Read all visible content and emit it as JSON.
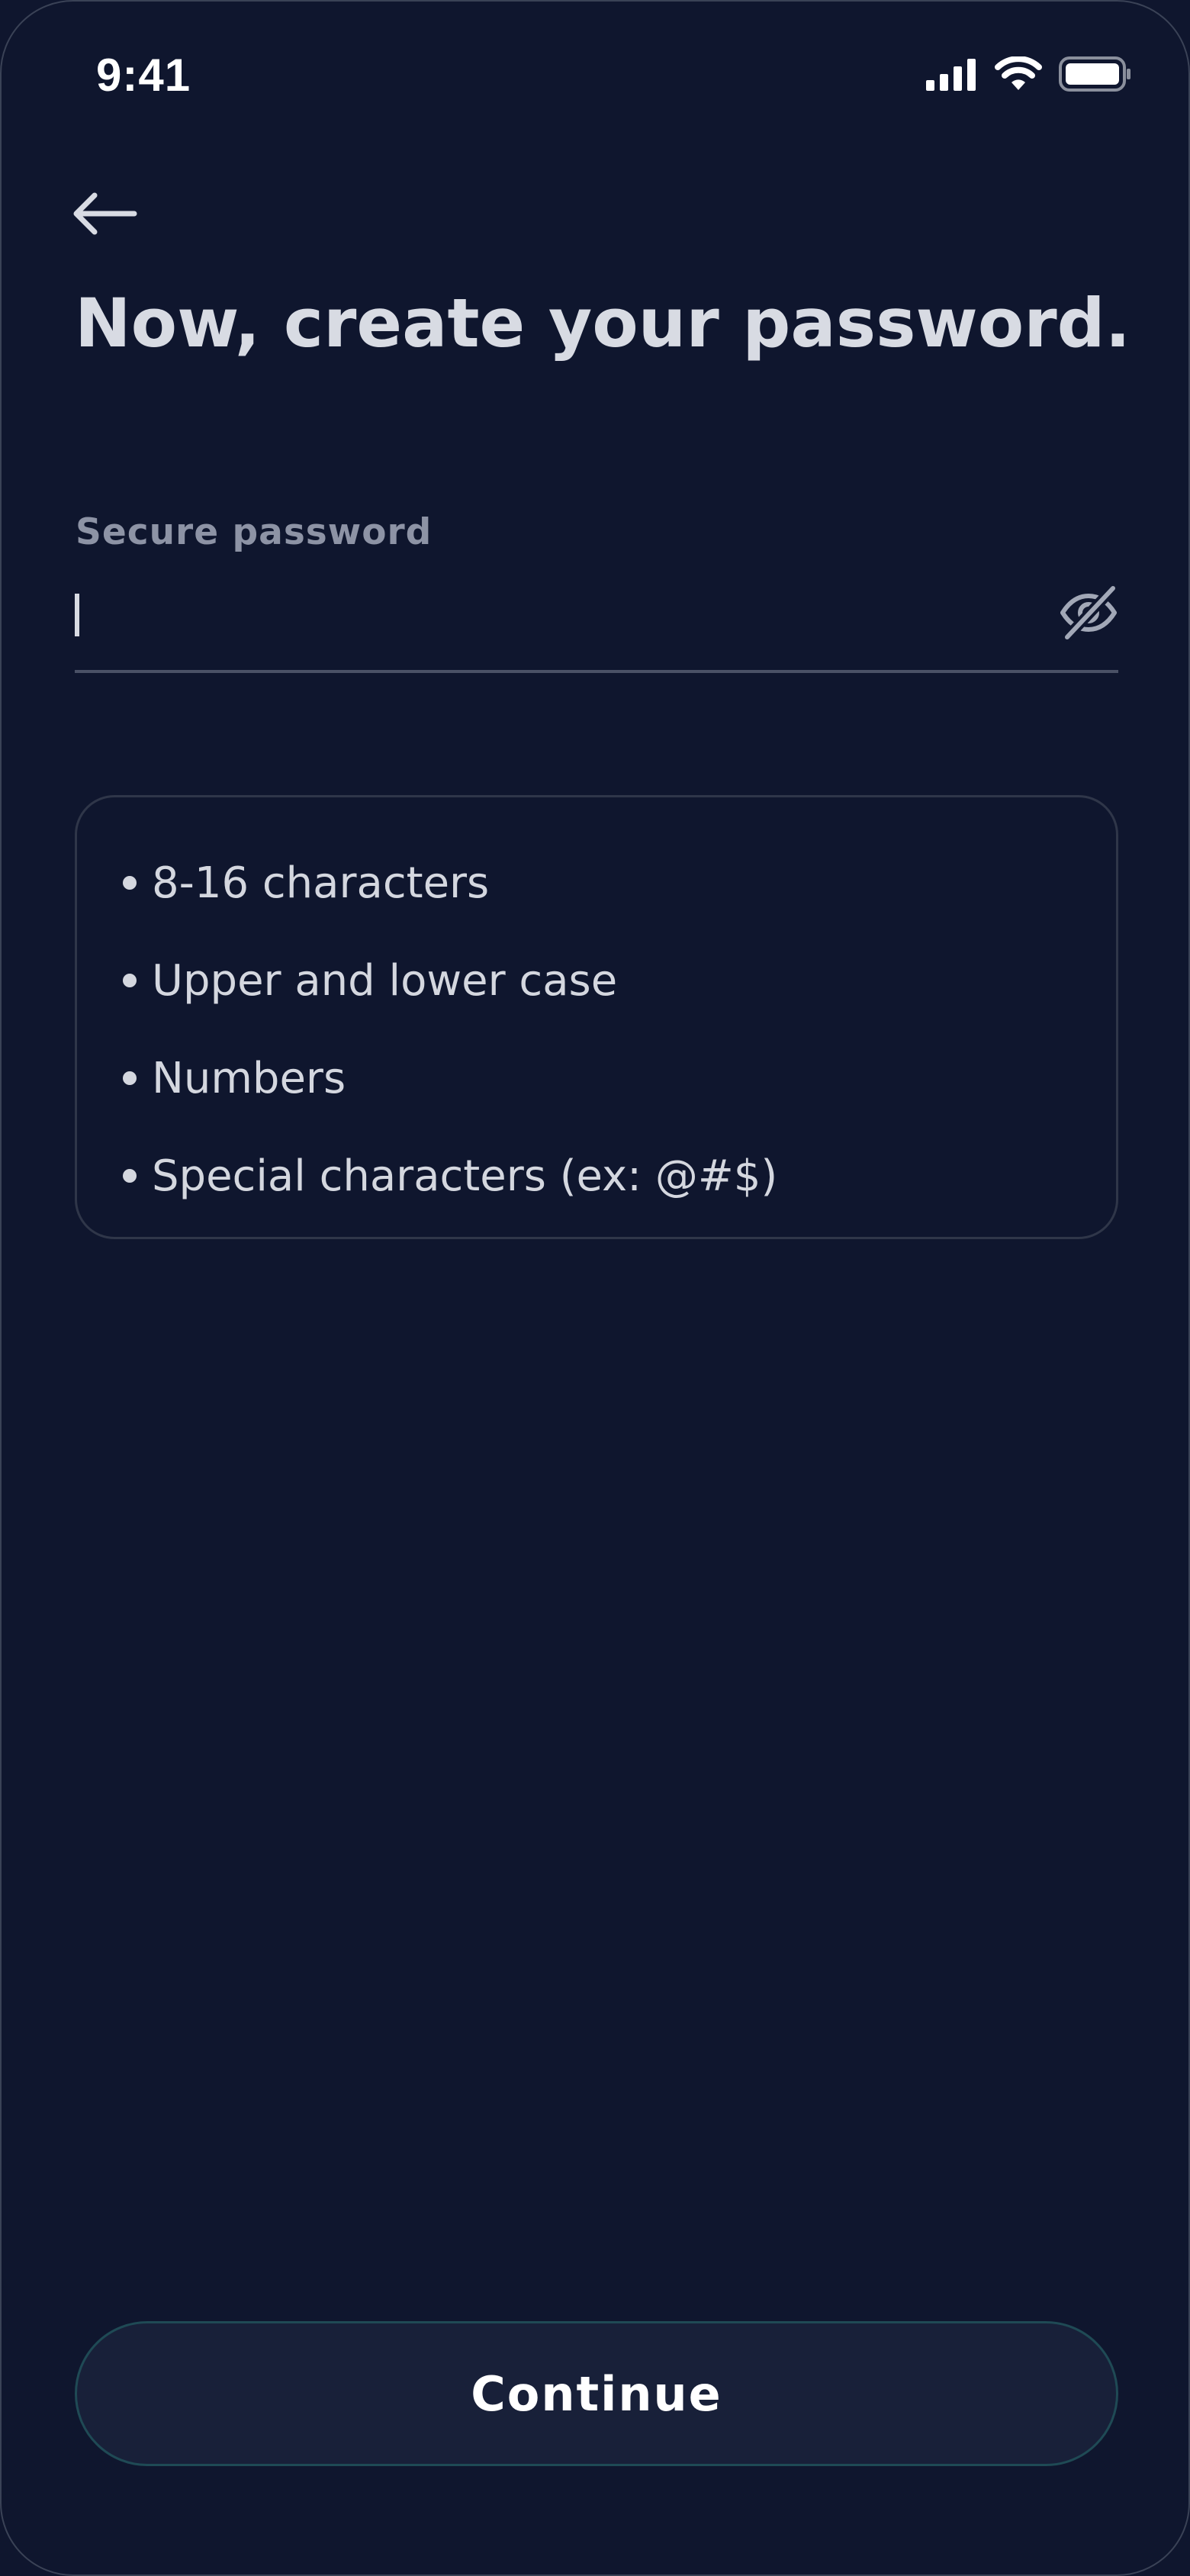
{
  "status_bar": {
    "time": "9:41",
    "icons": [
      "cellular-signal-icon",
      "wifi-icon",
      "battery-icon"
    ]
  },
  "header": {
    "back_icon": "arrow-left-icon",
    "title": "Now, create your password."
  },
  "password_field": {
    "label": "Secure password",
    "value": "",
    "visibility_icon": "eye-off-icon"
  },
  "requirements": [
    {
      "label": "8-16 characters"
    },
    {
      "label": "Upper and lower case"
    },
    {
      "label": "Numbers"
    },
    {
      "label": "Special characters (ex: @#$)"
    }
  ],
  "footer": {
    "continue_label": "Continue"
  },
  "colors": {
    "background": "#0f162e",
    "text_primary": "#d8dbe3",
    "text_muted": "#8d93a5",
    "button_border": "#1f4a55"
  }
}
